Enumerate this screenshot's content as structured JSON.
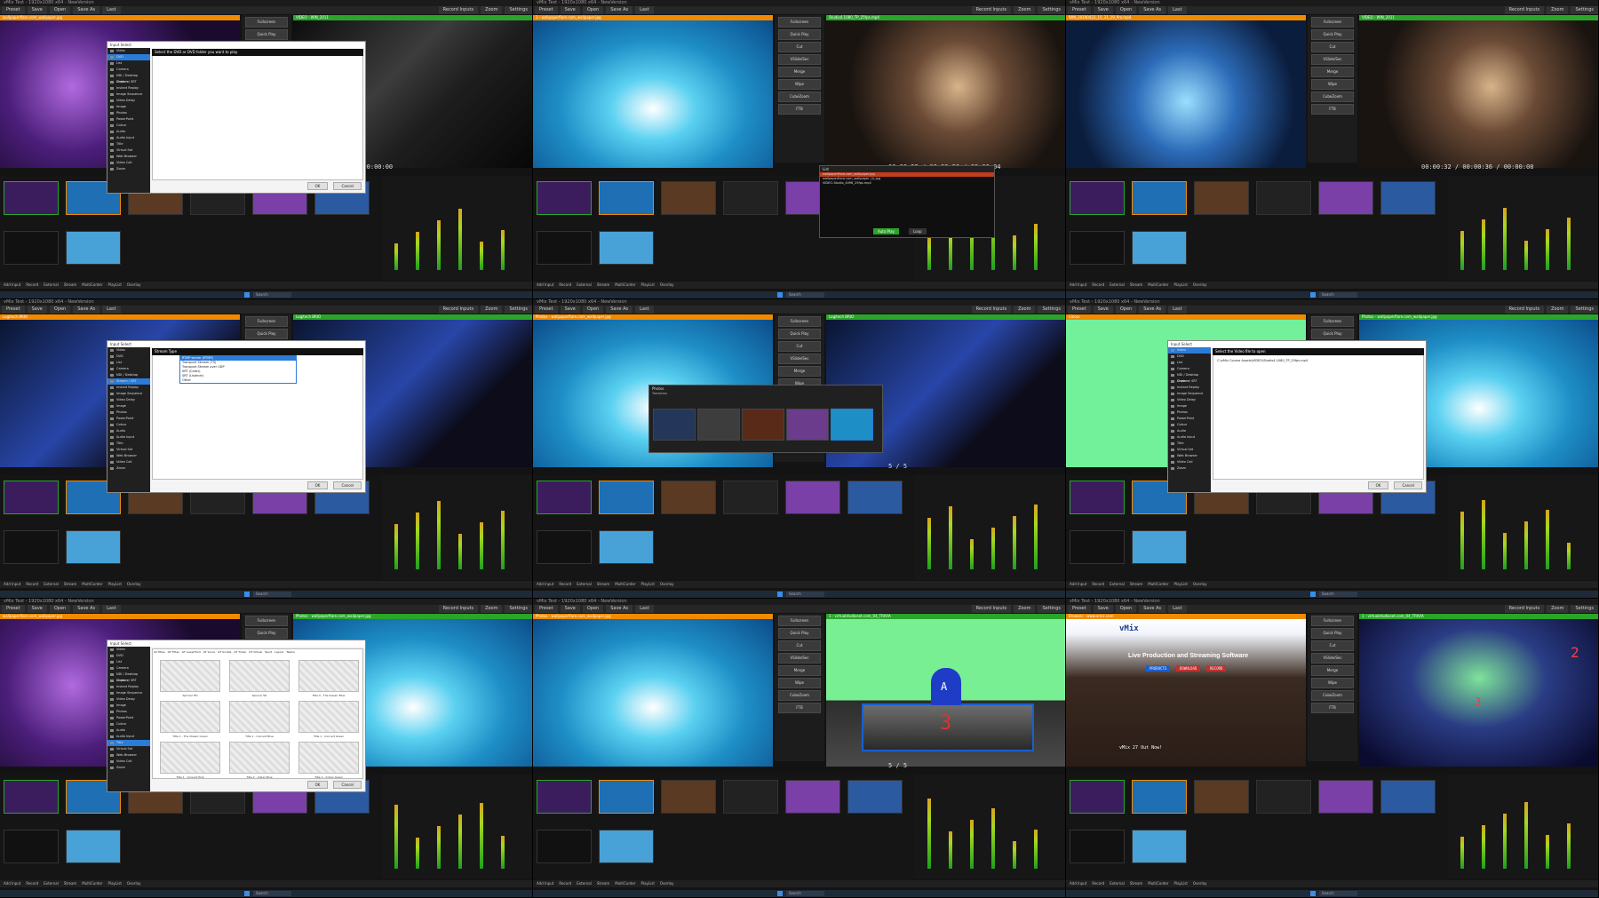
{
  "app": {
    "window_title": "vMix Test - 1920x1080 x64 - NewVersion"
  },
  "menu": {
    "preset": "Preset",
    "save": "Save",
    "open": "Open",
    "save_as": "Save As",
    "last": "Last",
    "record_inputs": "Record Inputs",
    "zoom": "Zoom",
    "settings": "Settings"
  },
  "transitions": {
    "fullscreen": "Fullscreen",
    "quick_play": "Quick Play",
    "cut": "Cut",
    "vslide_sec": "VSlide/Sec",
    "merge": "Merge",
    "wipe": "Wipe",
    "cube_zoom": "CubeZoom",
    "ftb": "FTB"
  },
  "bottom_bar": {
    "add_input": "Add Input",
    "record": "Record",
    "external": "External",
    "stream": "Stream",
    "multicorder": "MultiCorder",
    "playlist": "PlayList",
    "overlay": "Overlay"
  },
  "taskbar": {
    "search": "Search"
  },
  "colors": {
    "preview_bar": "#f08a00",
    "output_bar": "#2aa52a",
    "accent_blue": "#2b7bd8",
    "panel_dark": "#151515"
  },
  "shots": [
    {
      "preview_label": "wallpaperflare.com_wallpaper.jpg",
      "output_label": "VIDEO - WIN_2011",
      "timecode": "/ 00:00:00",
      "dialog": {
        "title": "Input Select",
        "prompt": "Select the DVD or DVD folder you want to play",
        "ok": "OK",
        "cancel": "Cancel",
        "side_items": [
          "Video",
          "DVD",
          "List",
          "Camera",
          "NDI / Desktop Capture",
          "Stream / SRT",
          "Instant Replay",
          "Image Sequence",
          "Video Delay",
          "Image",
          "Photos",
          "PowerPoint",
          "Colour",
          "Audio",
          "Audio Input",
          "Title",
          "Virtual Set",
          "Web Browser",
          "Video Call",
          "Zoom"
        ],
        "selected_index": 1
      }
    },
    {
      "preview_label": "3 - wallpaperflare.com_wallpaper.jpg",
      "output_label": "Studio4.1080_TP_25fps.mp4",
      "timecode": "00:00:32 / 00:00:36 / 00:00:04",
      "dialog": {
        "title": "List",
        "prompt": "",
        "ok": "Auto Play",
        "cancel": "Loop",
        "side_items": [],
        "selected_index": -1
      },
      "list_items": [
        "wallpaperflare.com_wallpaper.jpg",
        "wallpaperflare.com_wallpaper (1).jpg",
        "VIDEO-Studio_4096_25fps.mp4"
      ]
    },
    {
      "preview_label": "WIN_20190422_15_31_29_Pro.mp4",
      "output_label": "VIDEO - WIN_2011",
      "timecode": "00:00:32 / 00:00:36 / 00:00:08",
      "dialog": null
    },
    {
      "preview_label": "Logitech BRIO",
      "output_label": "Logitech BRIO",
      "timecode": "",
      "dialog": {
        "title": "Input Select",
        "prompt": "Stream Type",
        "ok": "OK",
        "cancel": "Cancel",
        "side_items": [
          "Video",
          "DVD",
          "List",
          "Camera",
          "NDI / Desktop Capture",
          "Stream / SRT",
          "Instant Replay",
          "Image Sequence",
          "Video Delay",
          "Image",
          "Photos",
          "PowerPoint",
          "Colour",
          "Audio",
          "Audio Input",
          "Title",
          "Virtual Set",
          "Web Browser",
          "Video Call",
          "Zoom"
        ],
        "selected_index": 5
      },
      "dropdown_options": [
        "RTMP server (RTMP)",
        "Transport Stream (TS)",
        "Transport Stream over UDP",
        "SRT (Caller)",
        "SRT (Listener)",
        "Other"
      ]
    },
    {
      "preview_label": "Photos - wallpaperflare.com_wallpaper.jpg",
      "output_label": "Logitech BRIO",
      "timecode": "5 / 5",
      "dialog": {
        "title": "Photos",
        "prompt": "Transition",
        "ok": "",
        "cancel": "",
        "side_items": [],
        "selected_index": -1
      }
    },
    {
      "preview_label": "Colour",
      "output_label": "Photos - wallpaperflare.com_wallpaper.jpg",
      "timecode": "",
      "dialog": {
        "title": "Input Select",
        "prompt": "Select the Video file to open",
        "ok": "OK",
        "cancel": "Cancel",
        "side_items": [
          "Video",
          "DVD",
          "List",
          "Camera",
          "NDI / Desktop Capture",
          "Stream / SRT",
          "Instant Replay",
          "Image Sequence",
          "Video Delay",
          "Image",
          "Photos",
          "PowerPoint",
          "Colour",
          "Audio",
          "Audio Input",
          "Title",
          "Virtual Set",
          "Web Browser",
          "Video Call",
          "Zoom"
        ],
        "selected_index": 0
      },
      "file_path": "C:\\vMix Course Assets\\VIDEO\\Studio4.1080_TP_25fps.mp4"
    },
    {
      "preview_label": "wallpaperflare.com_wallpaper.jpg",
      "output_label": "Photos - wallpaperflare.com_wallpaper.jpg",
      "timecode": "",
      "dialog": {
        "title": "Input Select",
        "prompt": "",
        "ok": "OK",
        "cancel": "Cancel",
        "side_items": [
          "Video",
          "DVD",
          "List",
          "Camera",
          "NDI / Desktop Capture",
          "Stream / SRT",
          "Instant Replay",
          "Image Sequence",
          "Video Delay",
          "Image",
          "Photos",
          "PowerPoint",
          "Colour",
          "Audio",
          "Audio Input",
          "Title",
          "Virtual Set",
          "Web Browser",
          "Video Call",
          "Zoom"
        ],
        "selected_index": 15
      },
      "title_tabs": [
        "All Titles",
        "GT Titles",
        "GT Lowerthird",
        "GT Score",
        "GT Scripts",
        "GT Ticker",
        "GT Virtual",
        "Sport",
        "Layout",
        "Teams"
      ],
      "title_items": [
        "Spinner HD",
        "Spinner SD",
        "Title 0 - The Classic Blue",
        "Title 1 - The Classic Green",
        "Title 1 - Concert Blue",
        "Title 1 - Concert Green",
        "Title 1 - Concert Pink",
        "Title 2 - Indian Blue",
        "Title 2 - Indian Green"
      ]
    },
    {
      "preview_label": "Photos - wallpaperflare.com_wallpaper.jpg",
      "output_label": "1 - virtualstudioset.com_04_TRIVIA",
      "timecode": "5 / 5",
      "dialog": null,
      "desk_number": "3",
      "presenter_letter": "A"
    },
    {
      "preview_label": "Browser - www.vmix.com",
      "output_label": "1 - virtualstudioset.com_04_TRIVIA",
      "timecode": "",
      "dialog": null,
      "web": {
        "brand": "vMix",
        "headline": "Live Production and Streaming Software",
        "btn_products": "PRODUCTS",
        "btn_download": "DOWNLOAD",
        "btn_record": "RECORD",
        "footer": "vMix 27 Out Now!"
      },
      "screen_numbers": [
        "2",
        "3"
      ]
    }
  ]
}
